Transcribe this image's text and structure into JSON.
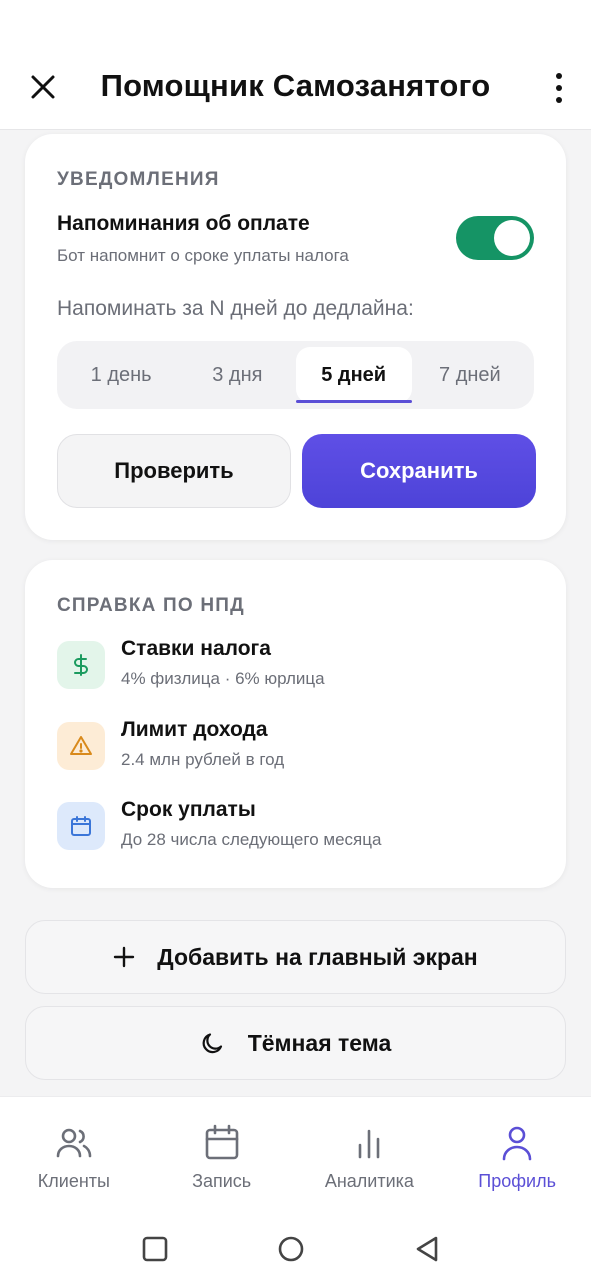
{
  "header": {
    "title": "Помощник Самозанятого"
  },
  "notifications": {
    "section_label": "УВЕДОМЛЕНИЯ",
    "reminder_title": "Напоминания об оплате",
    "reminder_subtitle": "Бот напомнит о сроке уплаты налога",
    "toggle_on": true,
    "days_label": "Напоминать за N дней до дедлайна:",
    "day_options": [
      "1 день",
      "3 дня",
      "5 дней",
      "7 дней"
    ],
    "selected_day": "5 дней",
    "check_label": "Проверить",
    "save_label": "Сохранить"
  },
  "help": {
    "section_label": "СПРАВКА ПО НПД",
    "items": [
      {
        "title": "Ставки налога",
        "subtitle": "4% физлица · 6% юрлица",
        "icon": "dollar-icon"
      },
      {
        "title": "Лимит дохода",
        "subtitle": "2.4 млн рублей в год",
        "icon": "warning-icon"
      },
      {
        "title": "Срок уплаты",
        "subtitle": "До 28 числа следующего месяца",
        "icon": "calendar-icon"
      }
    ]
  },
  "actions": {
    "add_home_label": "Добавить на главный экран",
    "dark_theme_label": "Тёмная тема"
  },
  "bottom_nav": {
    "items": [
      {
        "label": "Клиенты",
        "icon": "users-icon"
      },
      {
        "label": "Запись",
        "icon": "calendar-icon"
      },
      {
        "label": "Аналитика",
        "icon": "bar-chart-icon"
      },
      {
        "label": "Профиль",
        "icon": "user-icon"
      }
    ],
    "active": "Профиль"
  },
  "colors": {
    "accent": "#5b4fd6",
    "toggle_on": "#159465",
    "text_muted": "#6c6f78"
  }
}
